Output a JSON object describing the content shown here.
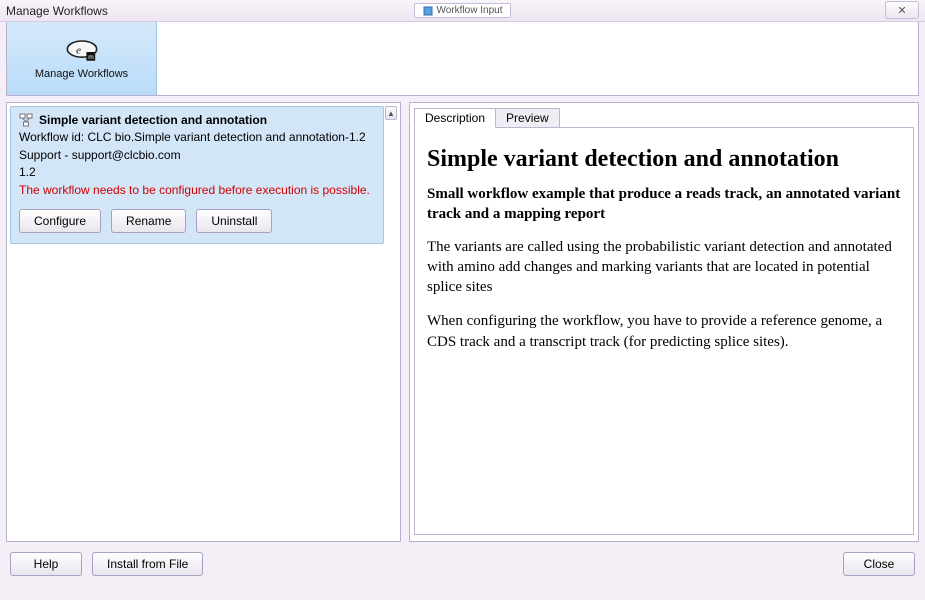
{
  "window": {
    "title": "Manage Workflows",
    "pill_label": "Workflow Input",
    "close_glyph": "✕"
  },
  "toolbar": {
    "tile_label": "Manage Workflows"
  },
  "workflow": {
    "title": "Simple variant detection and annotation",
    "id_line": "Workflow id: CLC bio.Simple variant detection and annotation-1.2",
    "support_line": "Support - support@clcbio.com",
    "version": "1.2",
    "warning": "The workflow needs to be configured before execution is possible.",
    "buttons": {
      "configure": "Configure",
      "rename": "Rename",
      "uninstall": "Uninstall"
    }
  },
  "tabs": {
    "description": "Description",
    "preview": "Preview",
    "active": "description"
  },
  "description": {
    "heading": "Simple variant detection and annotation",
    "subheading": "Small workflow example that produce a reads track, an annotated variant track and a mapping report",
    "para1": "The variants are called using the probabilistic variant detection and annotated with amino add changes and marking variants that are located in potential splice sites",
    "para2": "When configuring the workflow, you have to provide a reference genome, a CDS track and a transcript track (for predicting splice sites)."
  },
  "bottom": {
    "help": "Help",
    "install": "Install from File",
    "close": "Close"
  },
  "icons": {
    "scroll_up": "▲"
  }
}
